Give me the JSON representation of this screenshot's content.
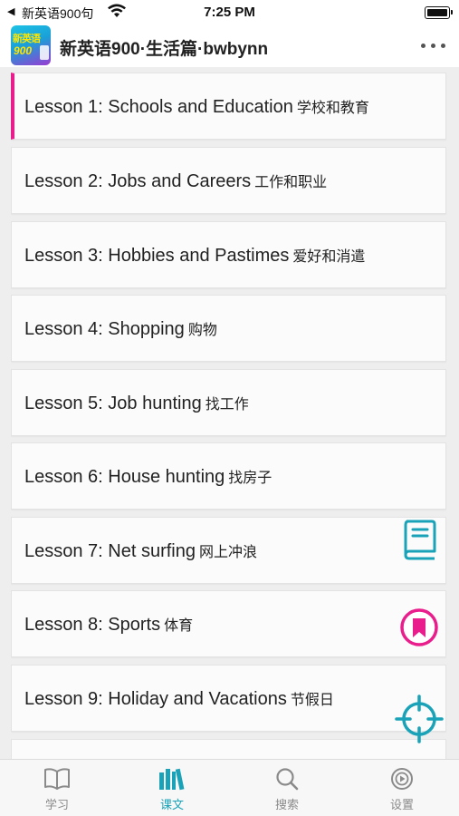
{
  "status_bar": {
    "back_glyph": "◀",
    "carrier": "新英语900句",
    "time": "7:25 PM"
  },
  "header": {
    "title": "新英语900·生活篇·bwbynn",
    "logo_text_1": "新英语",
    "logo_text_2": "900"
  },
  "lessons": [
    {
      "en": "Lesson 1: Schools and Education",
      "cn": "学校和教育",
      "active": true
    },
    {
      "en": "Lesson 2: Jobs and Careers",
      "cn": "工作和职业",
      "active": false
    },
    {
      "en": "Lesson 3: Hobbies and Pastimes",
      "cn": "爱好和消遣",
      "active": false
    },
    {
      "en": "Lesson 4: Shopping",
      "cn": "购物",
      "active": false
    },
    {
      "en": "Lesson 5: Job hunting",
      "cn": "找工作",
      "active": false
    },
    {
      "en": "Lesson 6: House hunting",
      "cn": "找房子",
      "active": false
    },
    {
      "en": "Lesson 7: Net surfing",
      "cn": "网上冲浪",
      "active": false
    },
    {
      "en": "Lesson 8: Sports",
      "cn": "体育",
      "active": false
    },
    {
      "en": "Lesson 9: Holiday and Vacations",
      "cn": "节假日",
      "active": false
    },
    {
      "en": "",
      "cn": "",
      "active": false
    }
  ],
  "fabs": {
    "book_icon": "book-icon",
    "bookmark_icon": "bookmark-icon",
    "locate_icon": "crosshair-icon"
  },
  "tabs": [
    {
      "label": "学习",
      "icon": "open-book-icon",
      "active": false
    },
    {
      "label": "课文",
      "icon": "books-icon",
      "active": true
    },
    {
      "label": "搜索",
      "icon": "search-icon",
      "active": false
    },
    {
      "label": "设置",
      "icon": "settings-icon",
      "active": false
    }
  ],
  "colors": {
    "accent": "#1aa3b8",
    "active_marker": "#e91e8c",
    "inactive_tab": "#8a8a8a"
  }
}
